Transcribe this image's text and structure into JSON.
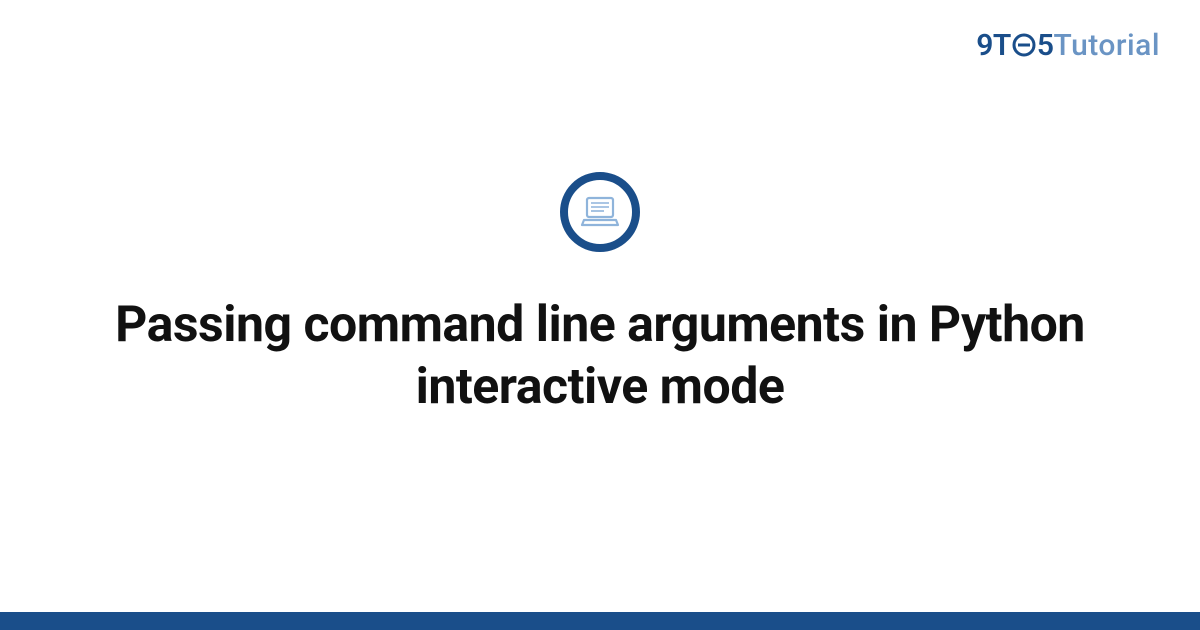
{
  "brand": {
    "nine": "9",
    "t": "T",
    "five": "5",
    "tutorial": "Tutorial"
  },
  "main": {
    "title": "Passing command line arguments in Python interactive mode",
    "icon": "laptop-icon"
  },
  "colors": {
    "primary": "#1a4e8a",
    "secondary": "#6a94c4",
    "laptop_stroke": "#8fb4db"
  }
}
